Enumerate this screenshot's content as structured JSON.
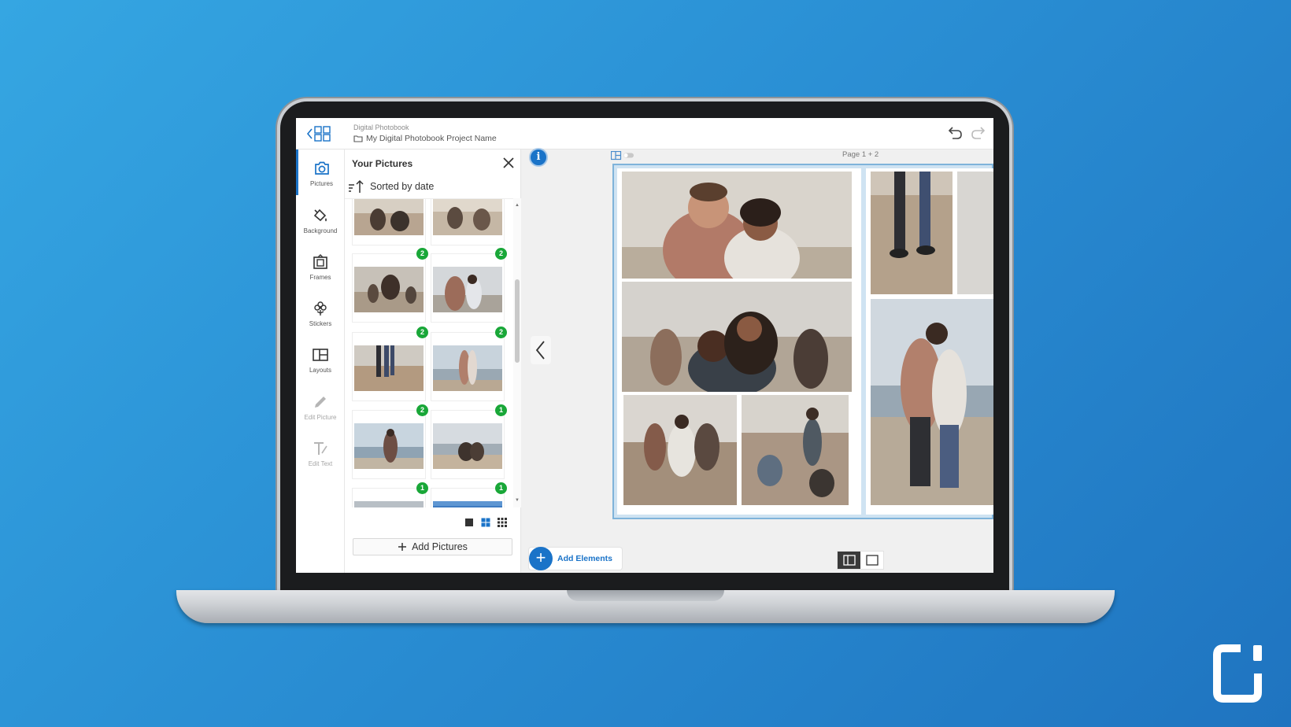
{
  "header": {
    "app_title": "Digital Photobook",
    "project_name": "My Digital Photobook Project Name"
  },
  "rail": {
    "items": [
      {
        "label": "Pictures",
        "icon": "camera-icon",
        "state": "active"
      },
      {
        "label": "Background",
        "icon": "paint-bucket-icon",
        "state": "normal"
      },
      {
        "label": "Frames",
        "icon": "frame-icon",
        "state": "normal"
      },
      {
        "label": "Stickers",
        "icon": "flower-sticker-icon",
        "state": "normal"
      },
      {
        "label": "Layouts",
        "icon": "layouts-icon",
        "state": "normal"
      },
      {
        "label": "Edit Picture",
        "icon": "pencil-icon",
        "state": "disabled"
      },
      {
        "label": "Edit Text",
        "icon": "text-icon",
        "state": "disabled"
      }
    ]
  },
  "panel": {
    "title": "Your Pictures",
    "sort_label": "Sorted by date",
    "add_pictures_label": "Add Pictures",
    "badges": [
      "2",
      "2",
      "2",
      "2",
      "2",
      "1",
      "1",
      "1"
    ]
  },
  "workspace": {
    "page_label": "Page 1 + 2",
    "add_elements_label": "Add Elements"
  },
  "colors": {
    "accent": "#1a73c8",
    "badge_green": "#19a738",
    "spread_border": "#7fb3da"
  }
}
